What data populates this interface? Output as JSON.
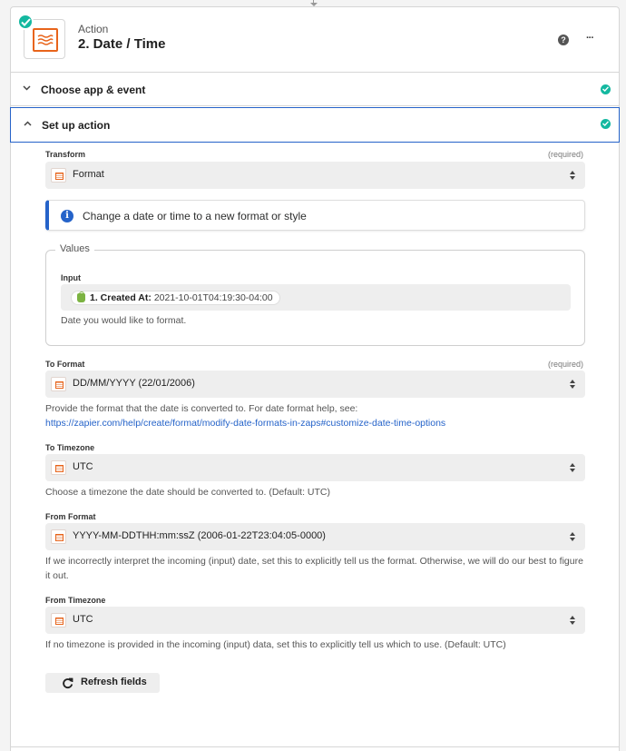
{
  "step": {
    "kicker": "Action",
    "title": "2. Date / Time",
    "app_icon": "formatter-icon",
    "status": "complete"
  },
  "header_actions": {
    "help_glyph": "?",
    "more_glyph": "···"
  },
  "sections": [
    {
      "label": "Choose app & event",
      "expanded": false,
      "complete": true
    },
    {
      "label": "Set up action",
      "expanded": true,
      "complete": true
    }
  ],
  "fields": {
    "transform": {
      "label": "Transform",
      "required": "(required)",
      "value": "Format"
    },
    "info": {
      "text": "Change a date or time to a new format or style"
    },
    "values": {
      "legend": "Values",
      "input_label": "Input",
      "pill_step": "1. Created At:",
      "pill_value": "2021-10-01T04:19:30-04:00",
      "help": "Date you would like to format."
    },
    "to_format": {
      "label": "To Format",
      "required": "(required)",
      "value": "DD/MM/YYYY (22/01/2006)",
      "help": "Provide the format that the date is converted to. For date format help, see:",
      "link": "https://zapier.com/help/create/format/modify-date-formats-in-zaps#customize-date-time-options"
    },
    "to_timezone": {
      "label": "To Timezone",
      "value": "UTC",
      "help": "Choose a timezone the date should be converted to. (Default: UTC)"
    },
    "from_format": {
      "label": "From Format",
      "value": "YYYY-MM-DDTHH:mm:ssZ (2006-01-22T23:04:05-0000)",
      "help": "If we incorrectly interpret the incoming (input) date, set this to explicitly tell us the format. Otherwise, we will do our best to figure it out."
    },
    "from_timezone": {
      "label": "From Timezone",
      "value": "UTC",
      "help": "If no timezone is provided in the incoming (input) data, set this to explicitly tell us which to use. (Default: UTC)"
    }
  },
  "refresh_button": {
    "label": "Refresh fields"
  },
  "colors": {
    "accent": "#2563c9",
    "success": "#14b8a0",
    "formatter": "#e8641b"
  }
}
